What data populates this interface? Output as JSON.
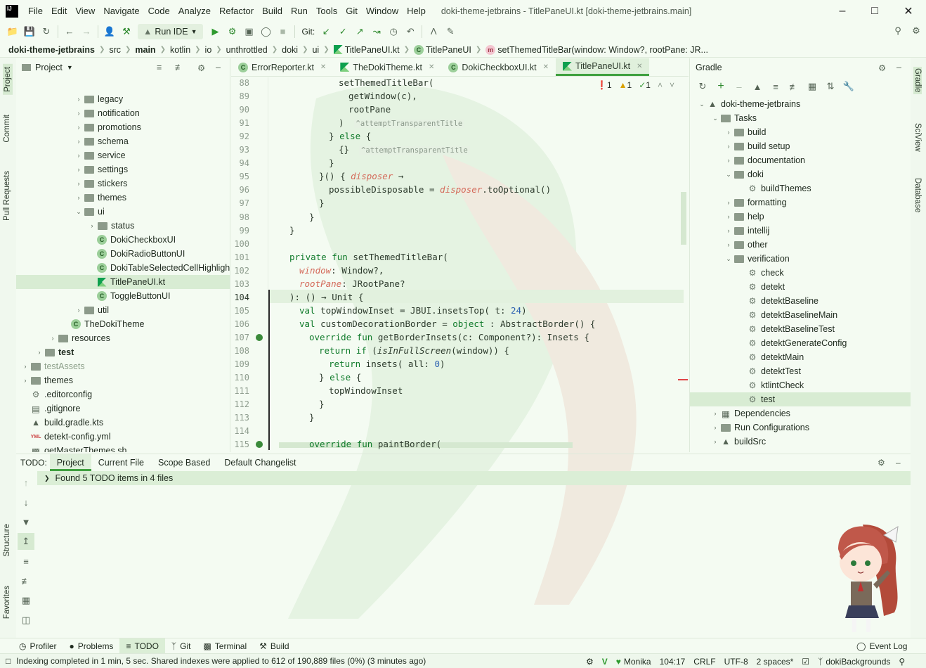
{
  "menubar": {
    "logo": "IJ",
    "items": [
      "File",
      "Edit",
      "View",
      "Navigate",
      "Code",
      "Analyze",
      "Refactor",
      "Build",
      "Run",
      "Tools",
      "Git",
      "Window",
      "Help"
    ],
    "title": "doki-theme-jetbrains - TitlePaneUI.kt [doki-theme-jetbrains.main]"
  },
  "toolbar": {
    "run_config": "Run IDE",
    "git_label": "Git:"
  },
  "breadcrumb": [
    "doki-theme-jetbrains",
    "src",
    "main",
    "kotlin",
    "io",
    "unthrottled",
    "doki",
    "ui",
    "TitlePaneUI.kt",
    "TitlePaneUI",
    "setThemedTitleBar(window: Window?, rootPane: JR..."
  ],
  "left_stripe": [
    "Project",
    "Commit",
    "Pull Requests",
    "Structure",
    "Favorites"
  ],
  "right_stripe": [
    "Gradle",
    "SciView",
    "Database"
  ],
  "project": {
    "title": "Project",
    "rows": [
      {
        "label": "legacy",
        "type": "folder",
        "arrow": "›"
      },
      {
        "label": "notification",
        "type": "folder",
        "arrow": "›"
      },
      {
        "label": "promotions",
        "type": "folder",
        "arrow": "›"
      },
      {
        "label": "schema",
        "type": "folder",
        "arrow": "›"
      },
      {
        "label": "service",
        "type": "folder",
        "arrow": "›"
      },
      {
        "label": "settings",
        "type": "folder",
        "arrow": "›"
      },
      {
        "label": "stickers",
        "type": "folder",
        "arrow": "›"
      },
      {
        "label": "themes",
        "type": "folder",
        "arrow": "›"
      },
      {
        "label": "ui",
        "type": "folder",
        "arrow": "⌄"
      },
      {
        "label": "status",
        "type": "folder",
        "arrow": "›"
      },
      {
        "label": "DokiCheckboxUI",
        "type": "class",
        "arrow": ""
      },
      {
        "label": "DokiRadioButtonUI",
        "type": "class",
        "arrow": ""
      },
      {
        "label": "DokiTableSelectedCellHighlightBorder",
        "type": "class",
        "arrow": ""
      },
      {
        "label": "TitlePaneUI.kt",
        "type": "kt",
        "arrow": ""
      },
      {
        "label": "ToggleButtonUI",
        "type": "class",
        "arrow": ""
      },
      {
        "label": "util",
        "type": "folder",
        "arrow": "›"
      },
      {
        "label": "TheDokiTheme",
        "type": "class",
        "arrow": ""
      },
      {
        "label": "resources",
        "type": "folder",
        "arrow": "›"
      },
      {
        "label": "test",
        "type": "folder",
        "arrow": "›"
      },
      {
        "label": "testAssets",
        "type": "folder",
        "arrow": "›"
      },
      {
        "label": "themes",
        "type": "folder",
        "arrow": "›"
      },
      {
        "label": ".editorconfig",
        "type": "gear",
        "arrow": ""
      },
      {
        "label": ".gitignore",
        "type": "file",
        "arrow": ""
      },
      {
        "label": "build.gradle.kts",
        "type": "gradle",
        "arrow": ""
      },
      {
        "label": "detekt-config.yml",
        "type": "yml",
        "arrow": ""
      },
      {
        "label": "getMasterThemes.sh",
        "type": "sh",
        "arrow": ""
      },
      {
        "label": "gradle.properties",
        "type": "file",
        "arrow": ""
      }
    ]
  },
  "editor": {
    "tabs": [
      "ErrorReporter.kt",
      "TheDokiTheme.kt",
      "DokiCheckboxUI.kt",
      "TitlePaneUI.kt"
    ],
    "active_tab": "TitlePaneUI.kt",
    "inspections": {
      "errors": "1",
      "warnings": "1",
      "weak": "1"
    },
    "line_numbers": [
      "88",
      "89",
      "90",
      "91",
      "92",
      "93",
      "94",
      "95",
      "96",
      "97",
      "98",
      "99",
      "100",
      "101",
      "102",
      "103",
      "104",
      "105",
      "106",
      "107",
      "108",
      "109",
      "110",
      "111",
      "112",
      "113",
      "114",
      "115"
    ],
    "code": [
      "setThemedTitleBar(",
      "getWindow(c),",
      "rootPane",
      ")",
      "} else {",
      "{}",
      "}",
      "}() { disposer →",
      "possibleDisposable = disposer.toOptional()",
      "}",
      "}",
      "}",
      "",
      "private fun setThemedTitleBar(",
      "window: Window?,",
      "rootPane: JRootPane?",
      "): () → Unit {",
      "val topWindowInset = JBUI.insetsTop( t: 24)",
      "val customDecorationBorder = object : AbstractBorder() {",
      "override fun getBorderInsets(c: Component?): Insets {",
      "return if (isInFullScreen(window)) {",
      "return insets( all: 0)",
      "} else {",
      "topWindowInset",
      "}",
      "}",
      "",
      "override fun paintBorder("
    ],
    "hints": {
      "attempt": "^attemptTransparentTitle"
    }
  },
  "gradle": {
    "title": "Gradle",
    "rows": [
      {
        "label": "doki-theme-jetbrains",
        "indent": 0,
        "arrow": "⌄",
        "type": "project"
      },
      {
        "label": "Tasks",
        "indent": 1,
        "arrow": "⌄",
        "type": "folder"
      },
      {
        "label": "build",
        "indent": 2,
        "arrow": "›",
        "type": "folder"
      },
      {
        "label": "build setup",
        "indent": 2,
        "arrow": "›",
        "type": "folder"
      },
      {
        "label": "documentation",
        "indent": 2,
        "arrow": "›",
        "type": "folder"
      },
      {
        "label": "doki",
        "indent": 2,
        "arrow": "⌄",
        "type": "folder"
      },
      {
        "label": "buildThemes",
        "indent": 3,
        "arrow": "",
        "type": "gear"
      },
      {
        "label": "formatting",
        "indent": 2,
        "arrow": "›",
        "type": "folder"
      },
      {
        "label": "help",
        "indent": 2,
        "arrow": "›",
        "type": "folder"
      },
      {
        "label": "intellij",
        "indent": 2,
        "arrow": "›",
        "type": "folder"
      },
      {
        "label": "other",
        "indent": 2,
        "arrow": "›",
        "type": "folder"
      },
      {
        "label": "verification",
        "indent": 2,
        "arrow": "⌄",
        "type": "folder"
      },
      {
        "label": "check",
        "indent": 3,
        "arrow": "",
        "type": "gear"
      },
      {
        "label": "detekt",
        "indent": 3,
        "arrow": "",
        "type": "gear"
      },
      {
        "label": "detektBaseline",
        "indent": 3,
        "arrow": "",
        "type": "gear"
      },
      {
        "label": "detektBaselineMain",
        "indent": 3,
        "arrow": "",
        "type": "gear"
      },
      {
        "label": "detektBaselineTest",
        "indent": 3,
        "arrow": "",
        "type": "gear"
      },
      {
        "label": "detektGenerateConfig",
        "indent": 3,
        "arrow": "",
        "type": "gear"
      },
      {
        "label": "detektMain",
        "indent": 3,
        "arrow": "",
        "type": "gear"
      },
      {
        "label": "detektTest",
        "indent": 3,
        "arrow": "",
        "type": "gear"
      },
      {
        "label": "ktlintCheck",
        "indent": 3,
        "arrow": "",
        "type": "gear"
      },
      {
        "label": "test",
        "indent": 3,
        "arrow": "",
        "type": "gear"
      },
      {
        "label": "Dependencies",
        "indent": 1,
        "arrow": "›",
        "type": "deps"
      },
      {
        "label": "Run Configurations",
        "indent": 1,
        "arrow": "›",
        "type": "folder"
      },
      {
        "label": "buildSrc",
        "indent": 1,
        "arrow": "›",
        "type": "project"
      }
    ]
  },
  "todo": {
    "label": "TODO:",
    "tabs": [
      "Project",
      "Current File",
      "Scope Based",
      "Default Changelist"
    ],
    "active": "Project",
    "result": "Found 5 TODO items in 4 files"
  },
  "bottom_tools": [
    "Profiler",
    "Problems",
    "TODO",
    "Git",
    "Terminal",
    "Build"
  ],
  "event_log": "Event Log",
  "status": {
    "message": "Indexing completed in 1 min, 5 sec. Shared indexes were applied to 612 of 190,889 files (0%) (3 minutes ago)",
    "theme": "Monika",
    "position": "104:17",
    "line_sep": "CRLF",
    "encoding": "UTF-8",
    "indent": "2 spaces*",
    "branch": "dokiBackgrounds"
  },
  "colors": {
    "accent": "#3fa03f",
    "background": "#f4fbf2",
    "keyword": "#0f7a2a",
    "italic_param": "#d46a5a"
  }
}
